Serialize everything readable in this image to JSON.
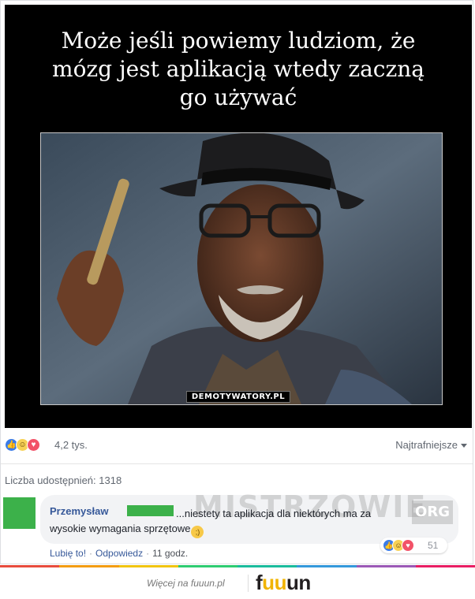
{
  "meme": {
    "caption_lines": [
      "Może jeśli powiemy ludziom, że",
      "mózg jest aplikacją wtedy zaczną",
      "go używać"
    ],
    "watermark": "DEMOTYWATORY.PL"
  },
  "reactions": {
    "icons": [
      "like-icon",
      "haha-icon",
      "love-icon"
    ],
    "count": "4,2 tys.",
    "sort_label": "Najtrafniejsze"
  },
  "shares": "Liczba udostępnień: 1318",
  "comment": {
    "author": "Przemysław",
    "text_line1": "...niestety ta aplikacja dla niektórych ma za",
    "text_line2": "wysokie wymagania sprzętowe",
    "emoji": "wink-emoji",
    "reaction_count": "51",
    "actions": {
      "like": "Lubię to!",
      "reply": "Odpowiedz",
      "time": "11 godz."
    }
  },
  "watermark": {
    "mistrzowie": "MISTRZOWIE",
    "org": "ORG"
  },
  "footer": {
    "more_text": "Więcej na fuuun.pl",
    "logo": "fuuun"
  },
  "colors": {
    "accent": "#365899",
    "like": "#3b7ce8",
    "love": "#f25268",
    "haha": "#f7d155",
    "censor": "#3cb14a",
    "stripe": [
      "#e84c3d",
      "#f39c12",
      "#f1c40f",
      "#2ecc71",
      "#1abc9c",
      "#3498db",
      "#9b59b6",
      "#e91e63"
    ]
  }
}
